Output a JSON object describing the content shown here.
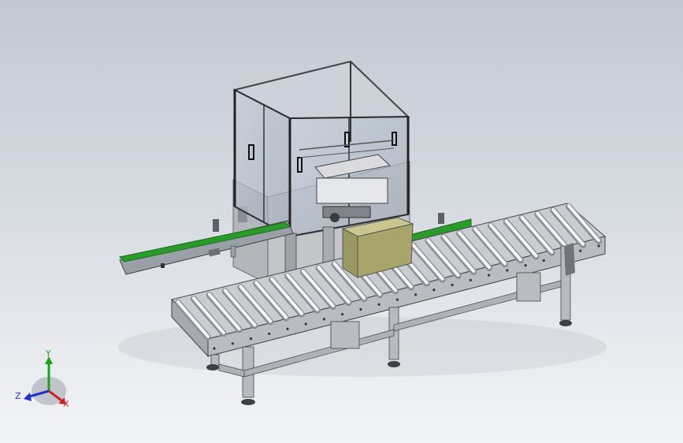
{
  "viewport": {
    "background_top": "#c2c8d2",
    "background_bottom": "#f3f4f6"
  },
  "model": {
    "part_colors": {
      "frame": "#5a5f66",
      "frame_light": "#9aa0a8",
      "glass": "#b9c3cf",
      "belt": "#2a9a2a",
      "roller": "#e6e8ec",
      "carton": "#a8a56a",
      "carton_top": "#c9c690",
      "cabinet": "#b6b8bc"
    }
  },
  "triad": {
    "y_label": "Y",
    "z_label": "Z",
    "x_label": "X",
    "y_color": "#1fa01f",
    "z_color": "#2233cc",
    "x_color": "#cc2222"
  }
}
